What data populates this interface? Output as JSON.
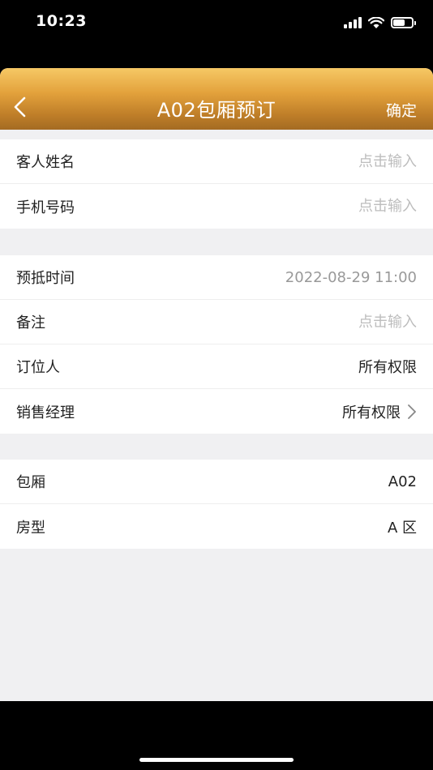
{
  "status_bar": {
    "time": "10:23"
  },
  "nav": {
    "title": "A02包厢预订",
    "confirm_label": "确定"
  },
  "groups": [
    {
      "rows": [
        {
          "label": "客人姓名",
          "placeholder": "点击输入"
        },
        {
          "label": "手机号码",
          "placeholder": "点击输入"
        }
      ]
    },
    {
      "rows": [
        {
          "label": "预抵时间",
          "value": "2022-08-29 11:00"
        },
        {
          "label": "备注",
          "placeholder": "点击输入"
        },
        {
          "label": "订位人",
          "value": "所有权限"
        },
        {
          "label": "销售经理",
          "value": "所有权限"
        }
      ]
    },
    {
      "rows": [
        {
          "label": "包厢",
          "value": "A02"
        },
        {
          "label": "房型",
          "value": "A 区"
        }
      ]
    }
  ],
  "colors": {
    "nav_top": "#f6c865",
    "nav_bottom": "#a46b22",
    "background": "#f0f0f2"
  }
}
